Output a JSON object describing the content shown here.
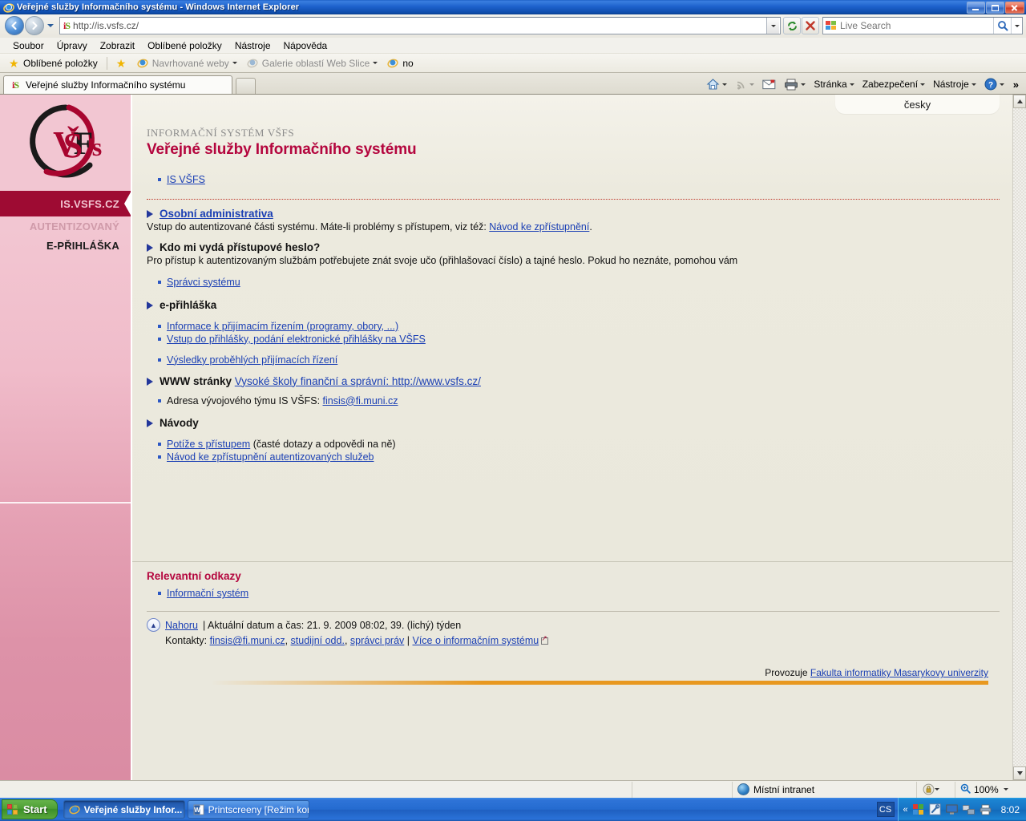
{
  "window": {
    "title": "Veřejné služby Informačního systému - Windows Internet Explorer",
    "minimize_label": "Minimalizovat",
    "maximize_label": "Maximalizovat",
    "close_label": "Zavřít"
  },
  "address_bar": {
    "url": "http://is.vsfs.cz/",
    "favicon": "is-favicon",
    "back_label": "Zpět",
    "forward_label": "Vpřed",
    "history_label": "Historie",
    "refresh_label": "Obnovit",
    "stop_label": "Zastavit"
  },
  "search": {
    "placeholder": "Live Search",
    "go_label": "Hledat"
  },
  "menu": {
    "items": [
      {
        "label": "Soubor"
      },
      {
        "label": "Úpravy"
      },
      {
        "label": "Zobrazit"
      },
      {
        "label": "Oblíbené položky"
      },
      {
        "label": "Nástroje"
      },
      {
        "label": "Nápověda"
      }
    ]
  },
  "favorites_bar": {
    "favorites_label": "Oblíbené položky",
    "items": [
      {
        "label": "Navrhované weby",
        "has_caret": true
      },
      {
        "label": "Galerie oblastí Web Slice",
        "has_caret": true
      },
      {
        "label": "no",
        "has_caret": false
      }
    ]
  },
  "tabs": {
    "items": [
      {
        "label": "Veřejné služby Informačního systému"
      }
    ],
    "new_tab_label": "Nová karta"
  },
  "command_bar": {
    "items": [
      {
        "label": "",
        "icon": "home-icon",
        "caret": true
      },
      {
        "label": "",
        "icon": "feeds-icon",
        "caret": true
      },
      {
        "label": "",
        "icon": "mail-icon",
        "caret": false
      },
      {
        "label": "",
        "icon": "print-icon",
        "caret": true
      },
      {
        "label": "Stránka",
        "icon": "page-icon",
        "caret": true
      },
      {
        "label": "Zabezpečení",
        "icon": "security-icon",
        "caret": true
      },
      {
        "label": "Nástroje",
        "icon": "tools-icon",
        "caret": true
      },
      {
        "label": "",
        "icon": "help-icon",
        "caret": true
      }
    ],
    "overflow_label": "»"
  },
  "page": {
    "lang_tab": "česky",
    "sidebar": {
      "logo_alt": "VŠFS",
      "current": "IS.VSFS.CZ",
      "links": [
        {
          "label": "AUTENTIZOVANÝ",
          "state": "dim"
        },
        {
          "label": "E-PŘIHLÁŠKA",
          "state": "dark"
        }
      ]
    },
    "kicker": "INFORMAČNÍ SYSTÉM VŠFS",
    "title": "Veřejné služby Informačního systému",
    "top_links": [
      {
        "label": "IS VŠFS"
      }
    ],
    "sections": [
      {
        "title": "Osobní administrativa",
        "title_is_link": true,
        "para_before": "Vstup do autentizované části systému. Máte-li problémy s přístupem, viz též: ",
        "para_link": "Návod ke zpřístupnění",
        "para_after": ".",
        "links": []
      },
      {
        "title": "Kdo mi vydá přístupové heslo?",
        "title_is_link": false,
        "para_before": "Pro přístup k autentizovaným službám potřebujete znát svoje učo (přihlašovací číslo) a tajné heslo. Pokud ho neznáte, pomohou vám",
        "para_link": "",
        "para_after": "",
        "links": [
          {
            "label": "Správci systému"
          }
        ]
      },
      {
        "title": "e-přihláška",
        "title_is_link": false,
        "para_before": "",
        "para_link": "",
        "para_after": "",
        "links": [
          {
            "label": "Informace k přijímacím řizením (programy, obory, ...)"
          },
          {
            "label": "Vstup do přihlášky, podání elektronické přihlášky na VŠFS"
          },
          {
            "label": "Výsledky proběhlých přijímacích řízení"
          }
        ]
      },
      {
        "title": "WWW stránky",
        "title_is_link": false,
        "title_suffix_link": "Vysoké školy finanční a správní: http://www.vsfs.cz/",
        "para_before": "",
        "para_link": "",
        "para_after": "",
        "plain_items": [
          {
            "prefix": "Adresa vývojového týmu IS VŠFS: ",
            "link": "finsis@fi.muni.cz",
            "suffix": ""
          }
        ],
        "links": []
      },
      {
        "title": "Návody",
        "title_is_link": false,
        "para_before": "",
        "para_link": "",
        "para_after": "",
        "plain_items": [
          {
            "prefix": "",
            "link": "Potíže s přístupem",
            "suffix": " (časté dotazy a odpovědi na ně)"
          },
          {
            "prefix": "",
            "link": "Návod ke zpřístupnění autentizovaných služeb",
            "suffix": ""
          }
        ],
        "links": []
      }
    ],
    "relevant": {
      "heading": "Relevantní odkazy",
      "links": [
        {
          "label": "Informační systém"
        }
      ]
    },
    "footer": {
      "up_label": "Nahoru",
      "datetime_text": "| Aktuální datum a čas: 21. 9. 2009 08:02, 39. (lichý) týden",
      "contacts_label": "Kontakty:",
      "contact_links": [
        {
          "label": "finsis@fi.muni.cz",
          "sep": ", "
        },
        {
          "label": "studijní odd.",
          "sep": ", "
        },
        {
          "label": "správci práv",
          "sep": " | "
        },
        {
          "label": "Více o informačním systému",
          "sep": ""
        }
      ],
      "provider_prefix": "Provozuje ",
      "provider_link": "Fakulta informatiky Masarykovy univerzity"
    }
  },
  "status_bar": {
    "message": "",
    "zone": "Místní intranet",
    "zoom": "100%"
  },
  "taskbar": {
    "start_label": "Start",
    "tasks": [
      {
        "label": "Veřejné služby Infor...",
        "icon": "ie-icon",
        "active": true
      },
      {
        "label": "Printscreeny [Režim kom...",
        "icon": "word-icon",
        "active": false
      }
    ],
    "language_indicator": "CS",
    "tray_expand": "«",
    "tray_icons": [
      "antivirus-icon",
      "tool-icon",
      "display-icon",
      "network-icon",
      "printer-icon"
    ],
    "clock": "8:02"
  },
  "colors": {
    "brand_crimson": "#b4063e",
    "sidebar_dark": "#9e0b33",
    "link_blue": "#1a3fb4",
    "accent_orange": "#e8981f"
  }
}
